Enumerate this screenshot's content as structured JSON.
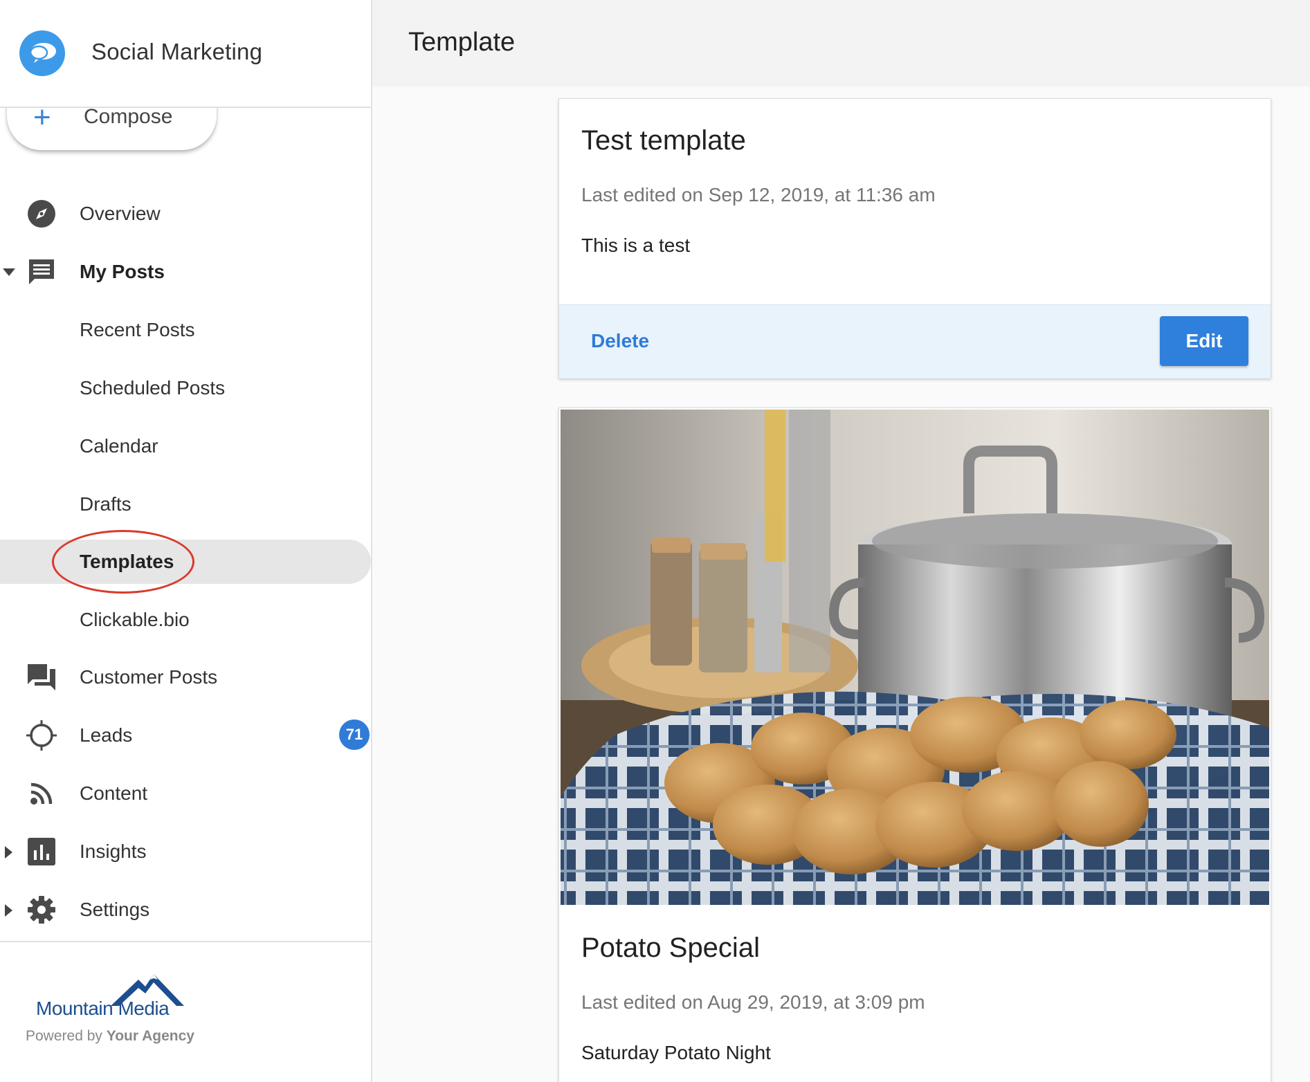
{
  "app": {
    "name": "Social Marketing",
    "page_title": "Template"
  },
  "sidebar": {
    "compose_label": "Compose",
    "items": [
      {
        "label": "Overview",
        "icon": "compass-icon"
      },
      {
        "label": "My Posts",
        "icon": "message-icon",
        "expanded": true
      },
      {
        "label": "Recent Posts"
      },
      {
        "label": "Scheduled Posts"
      },
      {
        "label": "Calendar"
      },
      {
        "label": "Drafts"
      },
      {
        "label": "Templates",
        "active": true
      },
      {
        "label": "Clickable.bio"
      },
      {
        "label": "Customer Posts",
        "icon": "forum-icon"
      },
      {
        "label": "Leads",
        "icon": "crosshair-icon",
        "badge": "71"
      },
      {
        "label": "Content",
        "icon": "rss-icon"
      },
      {
        "label": "Insights",
        "icon": "bar-chart-icon",
        "expanded": false
      },
      {
        "label": "Settings",
        "icon": "gear-icon",
        "expanded": false
      }
    ],
    "footer": {
      "agency_name": "Mountain Media",
      "powered_prefix": "Powered by",
      "powered_agency": "Your Agency"
    }
  },
  "templates": [
    {
      "title": "Test template",
      "last_edited": "Last edited on Sep 12, 2019, at 11:36 am",
      "body": "This is a test",
      "delete_label": "Delete",
      "edit_label": "Edit"
    },
    {
      "title": "Potato Special",
      "last_edited": "Last edited on Aug 29, 2019, at 3:09 pm",
      "body": "Saturday Potato Night",
      "image": "potatoes-and-pot-photo"
    }
  ],
  "colors": {
    "accent": "#2f80dc",
    "highlight_ring": "#d93a2b",
    "active_nav_bg": "#e6e6e6",
    "card_actions_bg": "#e9f3fc"
  }
}
